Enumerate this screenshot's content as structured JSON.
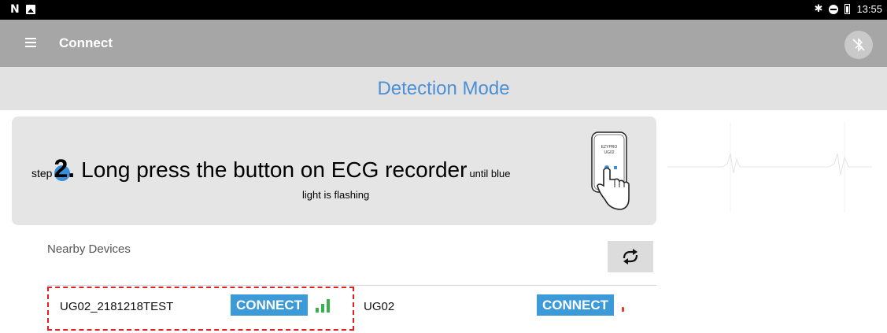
{
  "status_bar": {
    "left_icons": [
      "n-icon",
      "image-icon"
    ],
    "right_icons": [
      "bluetooth-icon",
      "do-not-disturb-icon",
      "battery-icon"
    ],
    "time": "13:55"
  },
  "app_bar": {
    "menu_icon": "hamburger-menu-icon",
    "title": "Connect",
    "action_icon": "bluetooth-disabled-icon"
  },
  "mode_title": "Detection Mode",
  "step": {
    "word": "step",
    "number": "2.",
    "main": "Long press the button on ECG recorder",
    "small": "until blue",
    "line2": "light is flashing",
    "device_label_1": "EZYPRO",
    "device_label_2": "UG02",
    "accent_color": "#3b8fd9"
  },
  "nearby": {
    "label": "Nearby Devices",
    "refresh_icon": "refresh-icon",
    "devices": [
      {
        "name": "UG02_2181218TEST",
        "connect_label": "CONNECT",
        "signal_icon": "signal-strength-icon",
        "signal_color": "#37b24d"
      },
      {
        "name": "UG02",
        "connect_label": "CONNECT",
        "signal_icon": "signal-weak-icon",
        "signal_color": "#e53935"
      }
    ]
  },
  "colors": {
    "status_bar": "#000000",
    "app_bar": "#a6a6a6",
    "mode_bar": "#e2e2e2",
    "mode_text": "#4d8fd6",
    "connect_button": "#3d9ad8",
    "highlight": "#e22222"
  }
}
